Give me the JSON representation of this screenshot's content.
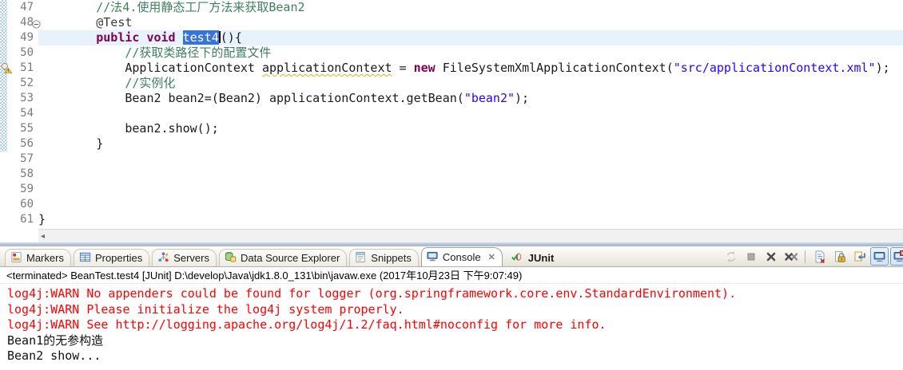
{
  "colors": {
    "comment": "#3F7F5F",
    "keyword": "#7F0055",
    "string": "#2A00FF",
    "plain": "#1a1a1a",
    "stderr_red": "#ff0000",
    "selection_bg": "#3874d8",
    "selection_fg": "#ffffff",
    "current_line_bg": "#e8f2fc",
    "line_number": "#7b7b7b",
    "range_hatch": "#aecde8",
    "warning_underline": "#d8b512"
  },
  "editor": {
    "lines": [
      {
        "num": "47",
        "indent": 8,
        "hatch": true,
        "tokens": [
          {
            "t": "comment",
            "v": "//法4.使用静态工厂方法来获取Bean2"
          }
        ]
      },
      {
        "num": "48",
        "indent": 8,
        "hatch": true,
        "fold": true,
        "tokens": [
          {
            "t": "annotation",
            "v": "@Test"
          }
        ]
      },
      {
        "num": "49",
        "indent": 8,
        "hatch": true,
        "current": true,
        "tokens": [
          {
            "t": "keyword",
            "v": "public void "
          },
          {
            "t": "selected",
            "v": "test4"
          },
          {
            "t": "cursor",
            "v": ""
          },
          {
            "t": "plain",
            "v": "(){"
          }
        ]
      },
      {
        "num": "50",
        "indent": 12,
        "hatch": true,
        "tokens": [
          {
            "t": "comment",
            "v": "//获取类路径下的配置文件"
          }
        ]
      },
      {
        "num": "51",
        "indent": 12,
        "hatch": true,
        "warn": true,
        "tokens": [
          {
            "t": "plain",
            "v": "ApplicationContext "
          },
          {
            "t": "warnvar",
            "v": "applicationContext"
          },
          {
            "t": "plain",
            "v": " = "
          },
          {
            "t": "keyword",
            "v": "new"
          },
          {
            "t": "plain",
            "v": " FileSystemXmlApplicationContext("
          },
          {
            "t": "string",
            "v": "\"src/applicationContext.xml\""
          },
          {
            "t": "plain",
            "v": ");"
          }
        ]
      },
      {
        "num": "52",
        "indent": 12,
        "hatch": true,
        "tokens": [
          {
            "t": "comment",
            "v": "//实例化"
          }
        ]
      },
      {
        "num": "53",
        "indent": 12,
        "hatch": true,
        "tokens": [
          {
            "t": "plain",
            "v": "Bean2 bean2=(Bean2) applicationContext.getBean("
          },
          {
            "t": "string",
            "v": "\"bean2\""
          },
          {
            "t": "plain",
            "v": ");"
          }
        ]
      },
      {
        "num": "54",
        "indent": 0,
        "hatch": true,
        "tokens": []
      },
      {
        "num": "55",
        "indent": 12,
        "hatch": true,
        "tokens": [
          {
            "t": "plain",
            "v": "bean2.show();"
          }
        ]
      },
      {
        "num": "56",
        "indent": 8,
        "hatch": true,
        "tokens": [
          {
            "t": "plain",
            "v": "}"
          }
        ]
      },
      {
        "num": "57",
        "indent": 0,
        "tokens": []
      },
      {
        "num": "58",
        "indent": 0,
        "tokens": []
      },
      {
        "num": "59",
        "indent": 0,
        "tokens": []
      },
      {
        "num": "60",
        "indent": 0,
        "tokens": []
      },
      {
        "num": "61",
        "indent": 0,
        "tokens": [
          {
            "t": "plain",
            "v": "}"
          }
        ]
      }
    ]
  },
  "console": {
    "tabs": [
      {
        "label": "Markers",
        "icon": "markers-icon"
      },
      {
        "label": "Properties",
        "icon": "properties-icon"
      },
      {
        "label": "Servers",
        "icon": "servers-icon"
      },
      {
        "label": "Data Source Explorer",
        "icon": "data-source-explorer-icon"
      },
      {
        "label": "Snippets",
        "icon": "snippets-icon"
      },
      {
        "label": "Console",
        "icon": "console-icon",
        "selected": true,
        "closable": true
      },
      {
        "label": "JUnit",
        "icon": "junit-icon",
        "bold": true
      }
    ],
    "toolbar": [
      {
        "name": "relaunch-icon",
        "disabled": true
      },
      {
        "name": "terminate-icon",
        "disabled": true
      },
      {
        "name": "remove-launch-icon"
      },
      {
        "name": "remove-all-terminated-icon"
      },
      {
        "name": "separator"
      },
      {
        "name": "clear-console-icon"
      },
      {
        "name": "scroll-lock-icon"
      },
      {
        "name": "show-console-on-output-icon"
      },
      {
        "name": "display-selected-console-icon",
        "pressed": true
      },
      {
        "name": "open-console-icon",
        "pressed": true
      }
    ],
    "status": "<terminated> BeanTest.test4 [JUnit] D:\\develop\\Java\\jdk1.8.0_131\\bin\\javaw.exe (2017年10月23日 下午9:07:49)",
    "output": [
      {
        "color": "red",
        "text": "log4j:WARN No appenders could be found for logger (org.springframework.core.env.StandardEnvironment)."
      },
      {
        "color": "red",
        "text": "log4j:WARN Please initialize the log4j system properly."
      },
      {
        "color": "red",
        "text": "log4j:WARN See http://logging.apache.org/log4j/1.2/faq.html#noconfig for more info."
      },
      {
        "color": "black",
        "text": "Bean1的无参构造"
      },
      {
        "color": "black",
        "text": "Bean2 show..."
      }
    ]
  }
}
